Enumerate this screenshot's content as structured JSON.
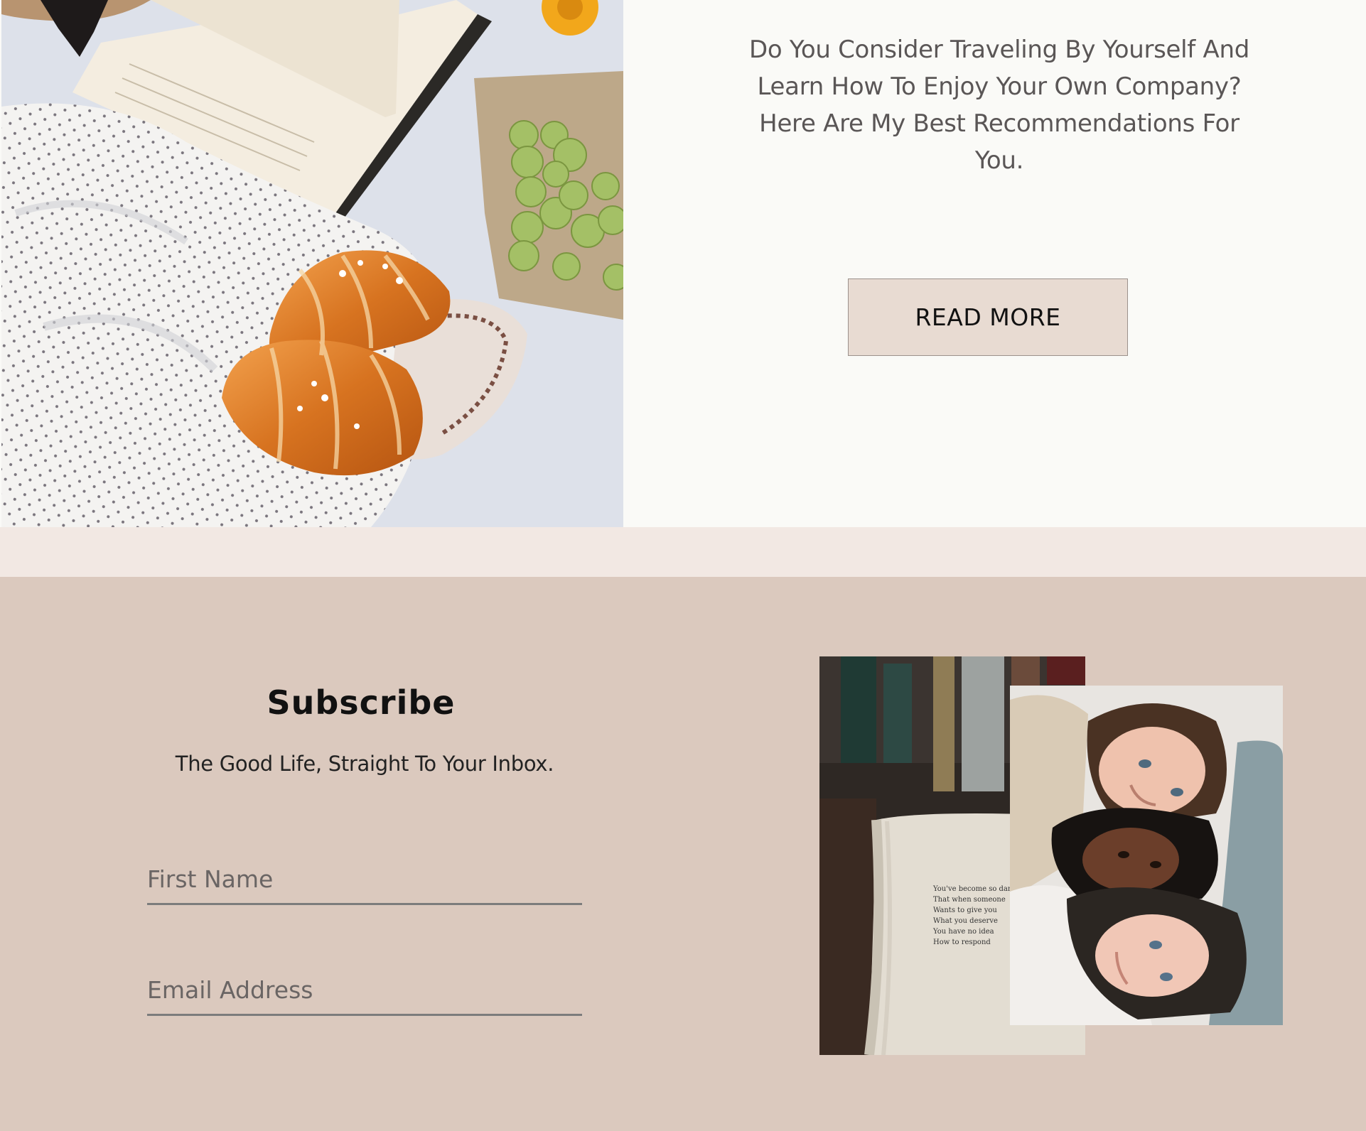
{
  "feature": {
    "text": "Do You Consider Traveling  By Yourself And Learn How To Enjoy Your Own Company? Here Are My Best Recommendations For You.",
    "read_more_label": "READ MORE"
  },
  "subscribe": {
    "title": "Subscribe",
    "tagline": "The Good Life, Straight To Your Inbox.",
    "first_name_placeholder": "First Name",
    "email_placeholder": "Email Address"
  },
  "book_photo": {
    "lines": [
      "You've become so damag",
      "That when someone",
      "Wants to give you",
      "What you deserve",
      "You have no idea",
      "How to respond"
    ]
  },
  "colors": {
    "background": "#dbc9be",
    "feature_background": "#fafaf7",
    "strip": "#f2e8e3",
    "button_background": "#e8dbd2"
  }
}
